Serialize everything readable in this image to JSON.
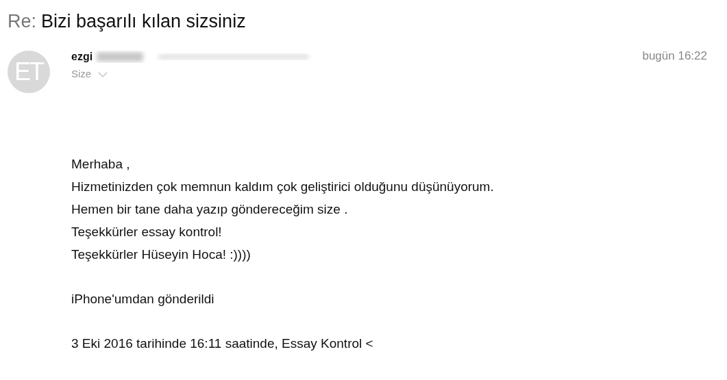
{
  "subject": {
    "prefix": "Re:",
    "text": "Bizi başarılı kılan sizsiniz"
  },
  "sender": {
    "avatar_initials": "ET",
    "name": "ezgi",
    "recipient": "Size",
    "time": "bugün 16:22"
  },
  "body": [
    [
      "Merhaba ,",
      "Hizmetinizden çok memnun kaldım çok geliştirici olduğunu düşünüyorum.",
      "Hemen bir tane daha yazıp göndereceğim size .",
      "Teşekkürler essay kontrol!",
      "Teşekkürler Hüseyin Hoca! :))))"
    ],
    [
      "iPhone'umdan gönderildi"
    ],
    [
      "3 Eki 2016 tarihinde 16:11 saatinde, Essay Kontrol <"
    ]
  ]
}
